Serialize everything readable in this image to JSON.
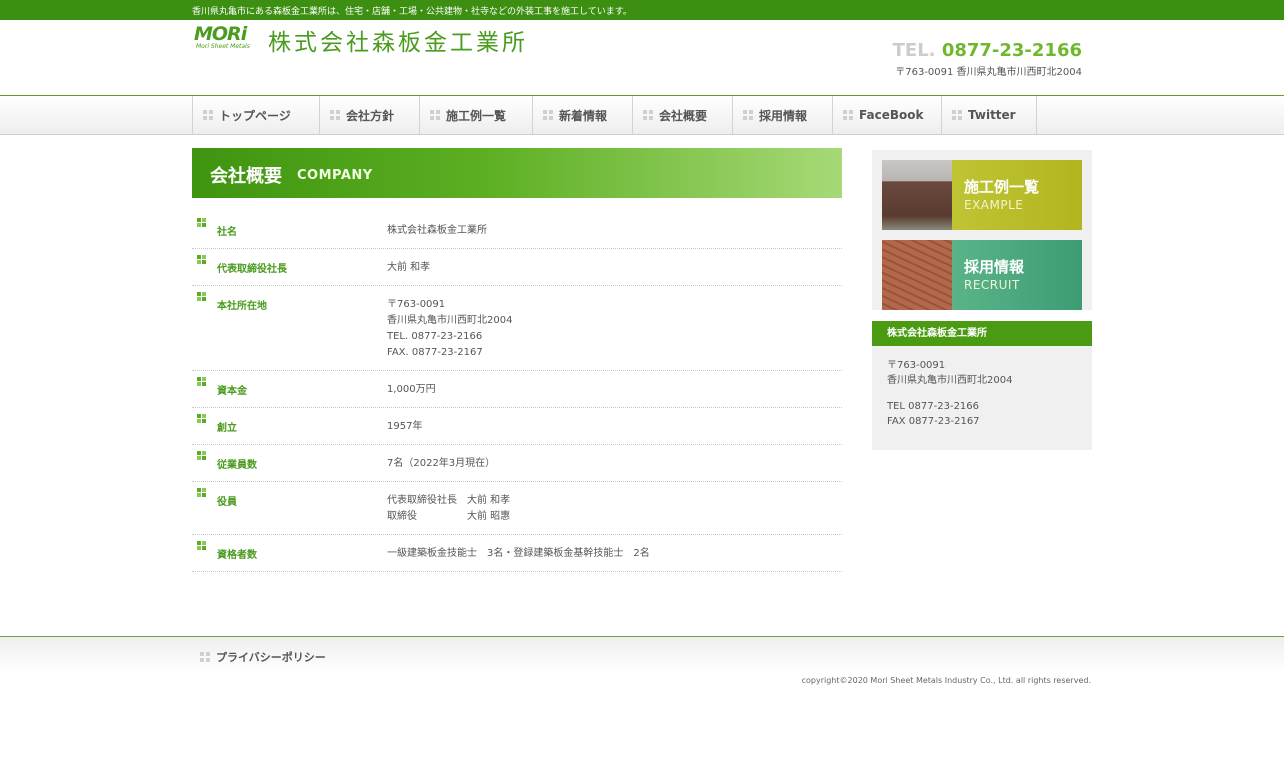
{
  "header": {
    "tagline": "香川県丸亀市にある森板金工業所は、住宅・店舗・工場・公共建物・社寺などの外装工事を施工しています。",
    "logo_mark": "MORi",
    "logo_sub": "Mori Sheet Metals",
    "company_name": "株式会社森板金工業所",
    "tel_label": "TEL.",
    "tel_number": "0877-23-2166",
    "address": "〒763-0091 香川県丸亀市川西町北2004"
  },
  "nav": {
    "items": [
      {
        "label": "トップページ"
      },
      {
        "label": "会社方針"
      },
      {
        "label": "施工例一覧"
      },
      {
        "label": "新着情報"
      },
      {
        "label": "会社概要"
      },
      {
        "label": "採用情報"
      },
      {
        "label": "FaceBook"
      },
      {
        "label": "Twitter"
      }
    ]
  },
  "main": {
    "heading_ja": "会社概要",
    "heading_en": "COMPANY",
    "rows": [
      {
        "label": "社名",
        "lines": [
          "株式会社森板金工業所"
        ]
      },
      {
        "label": "代表取締役社長",
        "lines": [
          "大前 和孝"
        ]
      },
      {
        "label": "本社所在地",
        "lines": [
          "〒763-0091",
          "香川県丸亀市川西町北2004",
          "TEL. 0877-23-2166",
          "FAX. 0877-23-2167"
        ]
      },
      {
        "label": "資本金",
        "lines": [
          "1,000万円"
        ]
      },
      {
        "label": "創立",
        "lines": [
          "1957年"
        ]
      },
      {
        "label": "従業員数",
        "lines": [
          "7名（2022年3月現在）"
        ]
      },
      {
        "label": "役員",
        "lines": [
          "代表取締役社長　大前 和孝",
          "取締役　　　　　大前 昭惠"
        ]
      },
      {
        "label": "資格者数",
        "lines": [
          "一級建築板金技能士　3名・登録建築板金基幹技能士　2名"
        ]
      }
    ]
  },
  "sidebar": {
    "banners": [
      {
        "title": "施工例一覧",
        "subtitle": "EXAMPLE"
      },
      {
        "title": "採用情報",
        "subtitle": "RECRUIT"
      }
    ],
    "company": {
      "title": "株式会社森板金工業所",
      "postal": "〒763-0091",
      "address": "香川県丸亀市川西町北2004",
      "tel": "TEL 0877-23-2166",
      "fax": "FAX 0877-23-2167"
    }
  },
  "footer": {
    "privacy_label": "プライバシーポリシー",
    "copyright": "copyright©2020 Mori Sheet Metals Industry Co., Ltd. all rights reserved."
  },
  "colors": {
    "brand_green": "#4a9b12",
    "accent_green": "#6fb82e"
  }
}
